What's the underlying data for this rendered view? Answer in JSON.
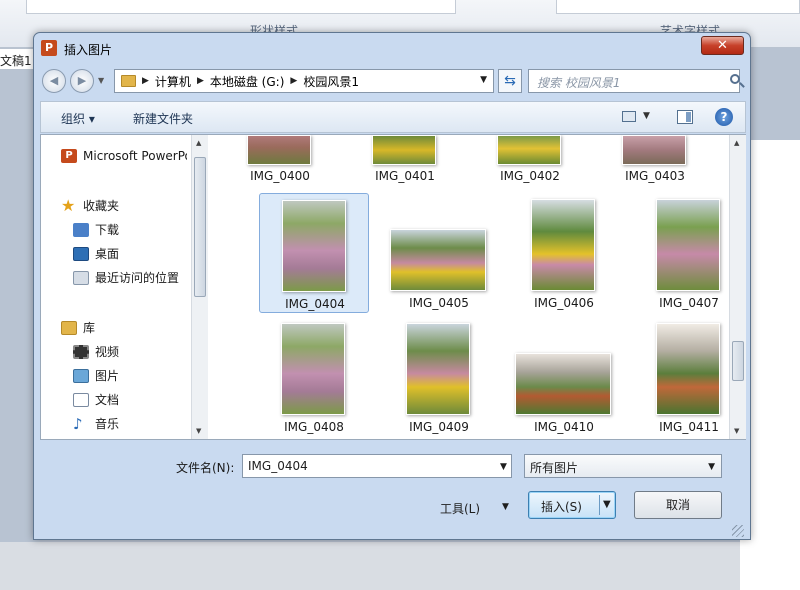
{
  "background": {
    "ribbon_group1": "形状样式",
    "ribbon_group2": "艺术字样式",
    "doc_tab": "文稿1"
  },
  "dialog": {
    "title": "插入图片",
    "app_icon_letter": "P",
    "close_glyph": "✕",
    "breadcrumb": [
      "计算机",
      "本地磁盘 (G:)",
      "校园风景1"
    ],
    "search_placeholder": "搜索 校园风景1",
    "toolbar": {
      "organize": "组织",
      "new_folder": "新建文件夹"
    },
    "nav_items": [
      {
        "label": "Microsoft PowerPoint",
        "icon": "powerpoint-icon"
      },
      {
        "label": "收藏夹",
        "icon": "star-icon"
      },
      {
        "label": "下载",
        "icon": "download-folder-icon"
      },
      {
        "label": "桌面",
        "icon": "desktop-icon"
      },
      {
        "label": "最近访问的位置",
        "icon": "recent-places-icon"
      },
      {
        "label": "库",
        "icon": "library-icon"
      },
      {
        "label": "视频",
        "icon": "video-icon"
      },
      {
        "label": "图片",
        "icon": "pictures-icon"
      },
      {
        "label": "文档",
        "icon": "documents-icon"
      },
      {
        "label": "音乐",
        "icon": "music-icon"
      }
    ],
    "files": [
      {
        "name": "IMG_0400",
        "selected": false
      },
      {
        "name": "IMG_0401",
        "selected": false
      },
      {
        "name": "IMG_0402",
        "selected": false
      },
      {
        "name": "IMG_0403",
        "selected": false
      },
      {
        "name": "IMG_0404",
        "selected": true
      },
      {
        "name": "IMG_0405",
        "selected": false
      },
      {
        "name": "IMG_0406",
        "selected": false
      },
      {
        "name": "IMG_0407",
        "selected": false
      },
      {
        "name": "IMG_0408",
        "selected": false
      },
      {
        "name": "IMG_0409",
        "selected": false
      },
      {
        "name": "IMG_0410",
        "selected": false
      },
      {
        "name": "IMG_0411",
        "selected": false
      }
    ],
    "filename_label": "文件名(N):",
    "filename_value": "IMG_0404",
    "filetype_value": "所有图片",
    "tools_label": "工具(L)",
    "insert_label": "插入(S)",
    "cancel_label": "取消"
  },
  "colors": {
    "selection_bg": "#dceaf9",
    "selection_border": "#84acdd",
    "close_button": "#c7412a",
    "dialog_frame": "#c9daf0"
  }
}
